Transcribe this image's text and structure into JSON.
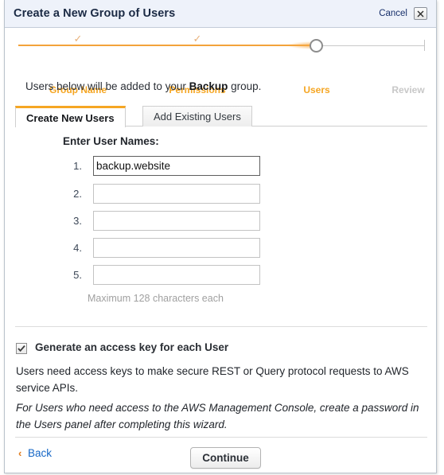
{
  "window": {
    "title": "Create a New Group of Users",
    "cancel_label": "Cancel",
    "close_icon": "close-x-icon"
  },
  "wizard": {
    "steps": [
      {
        "label": "Group Name",
        "state": "done",
        "marker": "check"
      },
      {
        "label": "Permissions",
        "state": "done",
        "marker": "check"
      },
      {
        "label": "Users",
        "state": "current",
        "marker": "circle"
      },
      {
        "label": "Review",
        "state": "pending",
        "marker": "none"
      }
    ]
  },
  "intro": {
    "prefix": "Users below will be added to your ",
    "group_name": "Backup",
    "suffix": " group."
  },
  "tabs": [
    {
      "label": "Create New Users",
      "active": true
    },
    {
      "label": "Add Existing Users",
      "active": false
    }
  ],
  "form": {
    "heading": "Enter User Names:",
    "rows": [
      {
        "number": "1.",
        "value": "backup.website",
        "focused": true
      },
      {
        "number": "2.",
        "value": "",
        "focused": false
      },
      {
        "number": "3.",
        "value": "",
        "focused": false
      },
      {
        "number": "4.",
        "value": "",
        "focused": false
      },
      {
        "number": "5.",
        "value": "",
        "focused": false
      }
    ],
    "hint": "Maximum 128 characters each"
  },
  "access_key": {
    "checked": true,
    "label": "Generate an access key for each User",
    "paragraph_1": "Users need access keys to make secure REST or Query protocol requests to AWS service APIs.",
    "paragraph_2": "For Users who need access to the AWS Management Console, create a password in the Users panel after completing this wizard."
  },
  "footer": {
    "back_chevron": "‹",
    "back_label": "Back",
    "continue_label": "Continue"
  },
  "colors": {
    "accent_orange": "#f5a623",
    "titlebar_bg": "#eef2fa",
    "link_blue": "#1667c6",
    "pending_gray": "#c8c8c8"
  }
}
